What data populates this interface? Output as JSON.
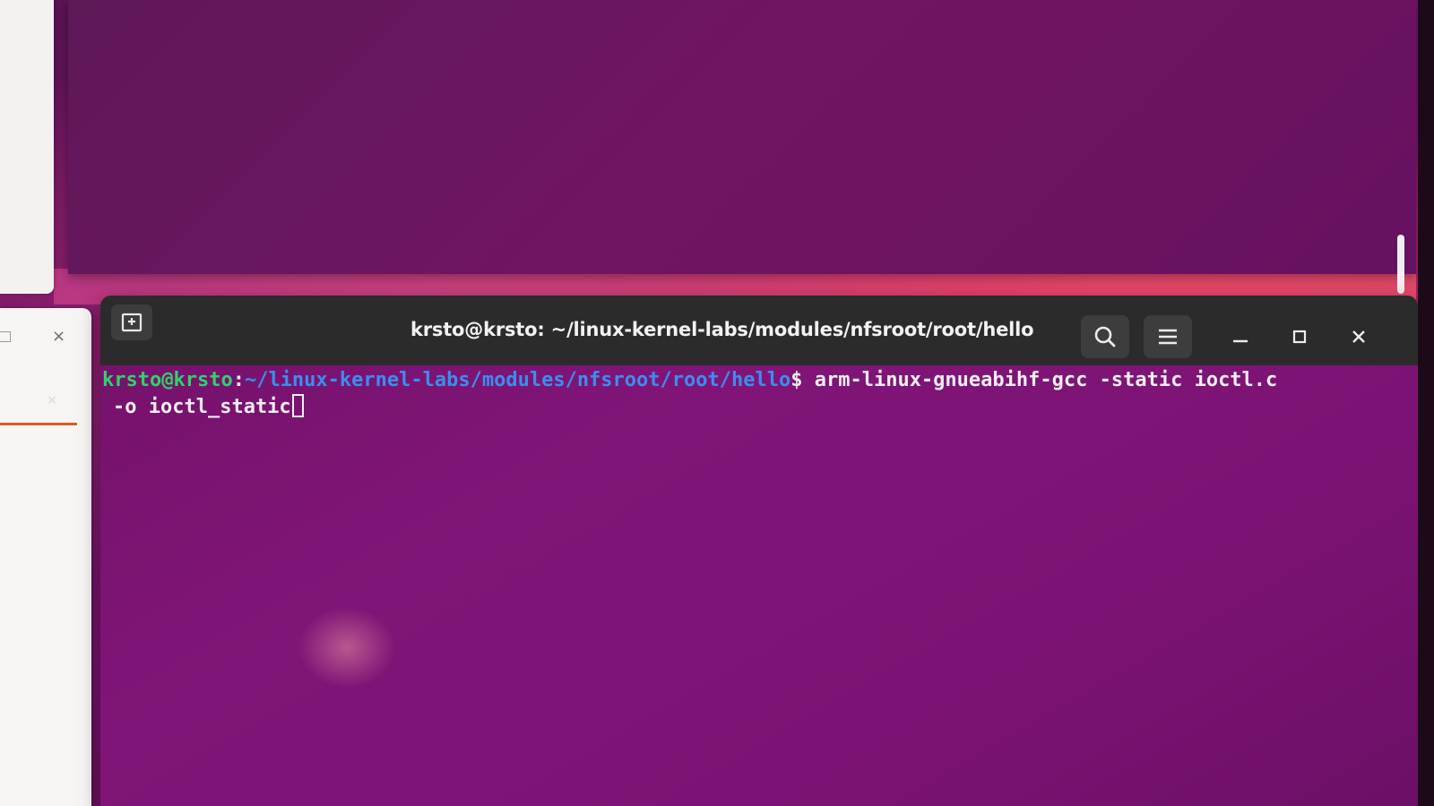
{
  "window": {
    "title": "krsto@krsto: ~/linux-kernel-labs/modules/nfsroot/root/hello"
  },
  "headerbar": {
    "new_tab_icon": "new-tab-icon",
    "search_icon": "search-icon",
    "menu_icon": "hamburger-menu-icon",
    "minimize_icon": "minimize-icon",
    "maximize_icon": "maximize-icon",
    "close_icon": "close-icon"
  },
  "terminal": {
    "prompt_user": "krsto@krsto",
    "prompt_colon": ":",
    "prompt_path": "~/linux-kernel-labs/modules/nfsroot/root/hello",
    "prompt_dollar": "$",
    "command_line1": " arm-linux-gnueabihf-gcc -static ioctl.c",
    "command_line2": "-o ioctl_static"
  },
  "left_window": {
    "close_glyph": "×"
  },
  "colors": {
    "prompt_user": "#2fd36a",
    "prompt_path": "#3b8ef0",
    "terminal_bg": "#7c1374",
    "headerbar_bg": "#2b2b2b",
    "accent": "#e95420"
  }
}
